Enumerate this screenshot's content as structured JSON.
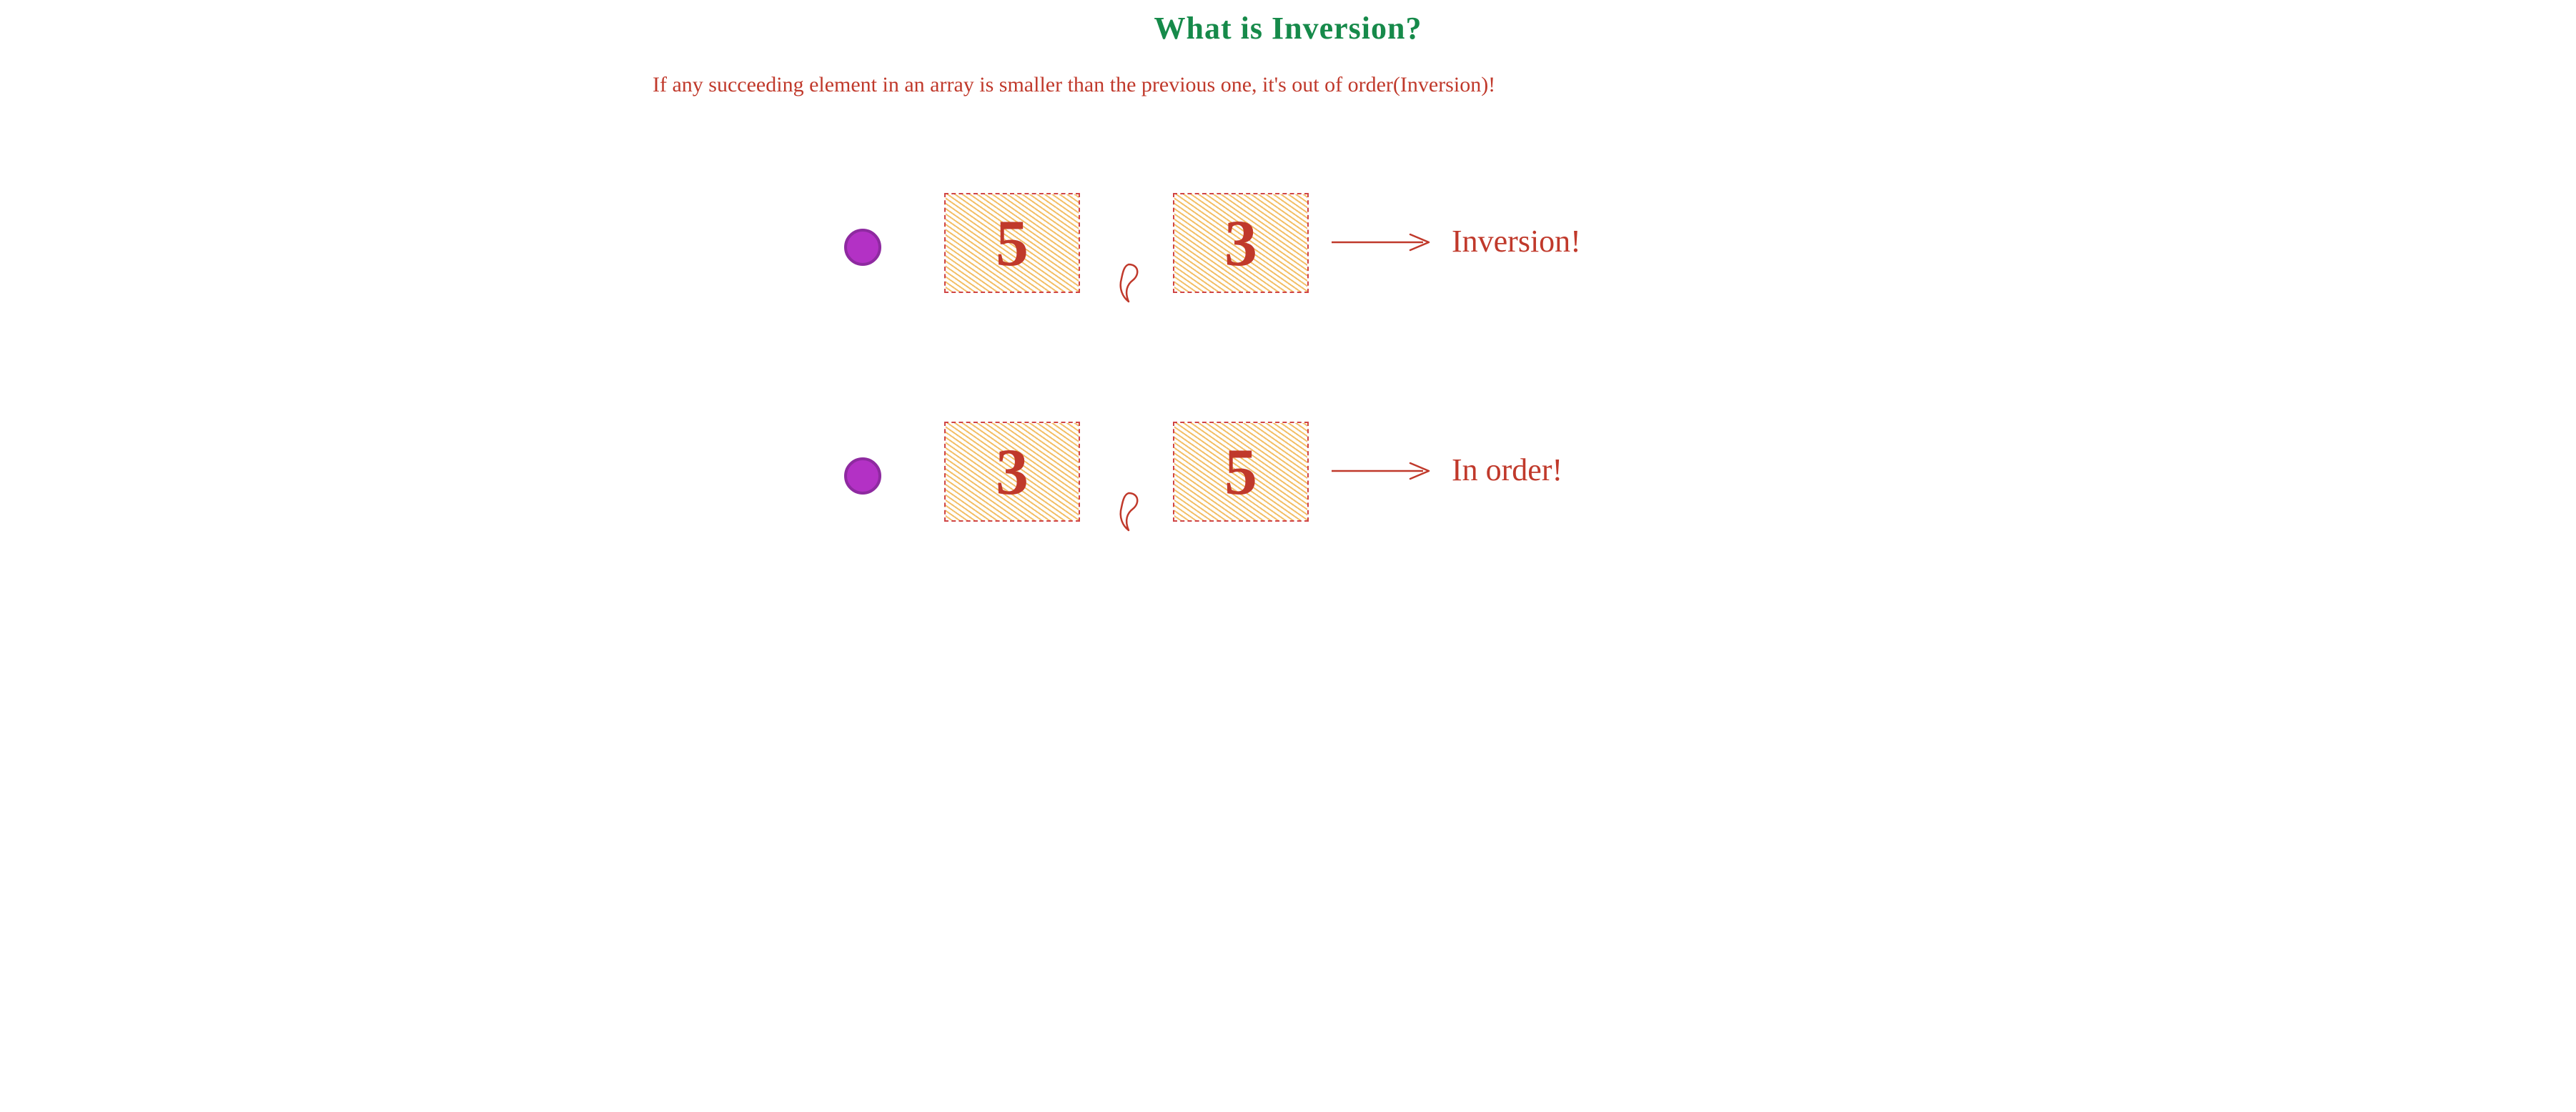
{
  "title": "What is Inversion?",
  "subtitle": "If any succeeding element in an array is smaller than the previous one, it's out of order(Inversion)!",
  "examples": [
    {
      "first": "5",
      "second": "3",
      "label": "Inversion!"
    },
    {
      "first": "3",
      "second": "5",
      "label": "In order!"
    }
  ],
  "colors": {
    "title": "#168a4a",
    "text_red": "#c0392b",
    "hatch": "#f1b44c",
    "bullet_fill": "#b331c5",
    "bullet_stroke": "#8e2aa0"
  }
}
